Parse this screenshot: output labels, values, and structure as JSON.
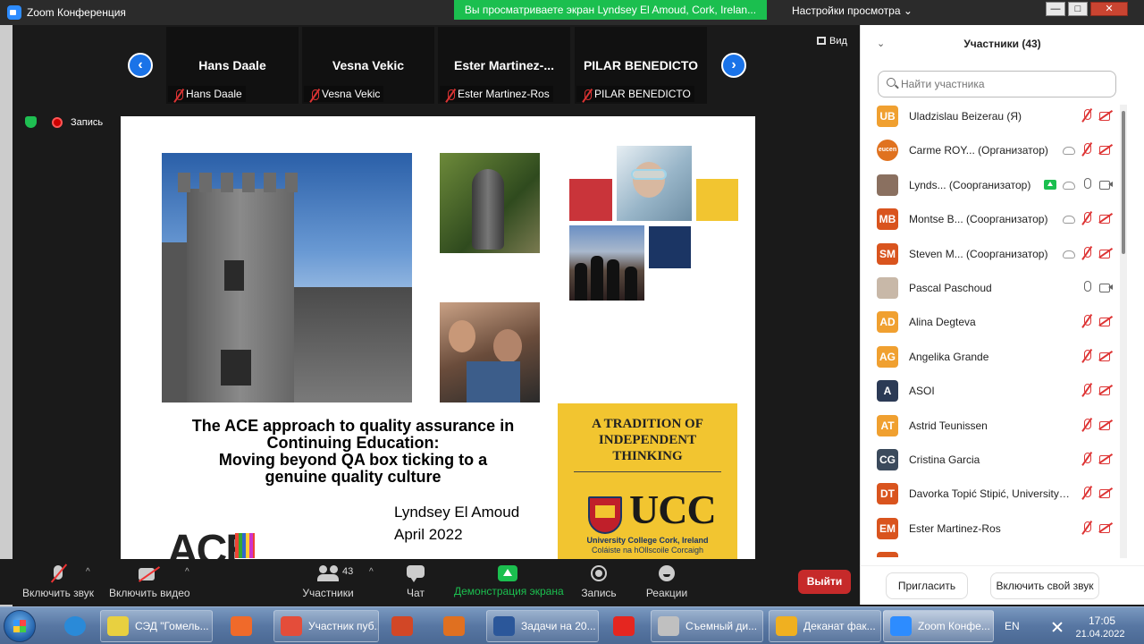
{
  "window": {
    "title": "Zoom Конференция",
    "share_banner": "Вы просматриваете экран Lyndsey El Amoud, Cork, Irelan...",
    "view_settings": "Настройки просмотра",
    "minimize": "—",
    "maximize": "□",
    "close": "✕"
  },
  "strip": {
    "prev": "‹",
    "next": "›",
    "view_label": "Вид",
    "tiles": [
      {
        "big": "Hans Daale",
        "small": "Hans Daale"
      },
      {
        "big": "Vesna Vekic",
        "small": "Vesna Vekic"
      },
      {
        "big": "Ester  Martinez-...",
        "small": "Ester Martinez-Ros"
      },
      {
        "big": "PILAR BENEDICTO",
        "small": "PILAR BENEDICTO"
      }
    ]
  },
  "recording": {
    "label": "Запись"
  },
  "slide": {
    "title_lines": [
      "The ACE approach to quality assurance in",
      "Continuing Education:",
      "Moving beyond QA box ticking to a",
      "genuine quality culture"
    ],
    "author": "Lyndsey El Amoud",
    "date": "April 2022",
    "ace_logo": "ACE",
    "ucc_tagline_lines": [
      "A TRADITION OF",
      "INDEPENDENT",
      "THINKING"
    ],
    "ucc_brand": "UCC",
    "ucc_english": "University College Cork, Ireland",
    "ucc_irish": "Coláiste na hOllscoile Corcaigh"
  },
  "participants": {
    "title": "Участники (43)",
    "search_placeholder": "Найти участника",
    "colors": {
      "orange": "#e0721f",
      "navy": "#2b3a55",
      "dark": "#3b4a5c"
    },
    "items": [
      {
        "initials": "UB",
        "avatar_color": "#f0a030",
        "name": "Uladzislau Beizerau (Я)",
        "icons": [
          "mic-off-icon",
          "video-off-icon"
        ]
      },
      {
        "initials": "eucen",
        "avatar_color": "#e0721f",
        "name": "Carme ROY... (Организатор)",
        "icons": [
          "cloud-icon",
          "mic-off-icon",
          "video-off-icon"
        ]
      },
      {
        "initials": "",
        "avatar_color": "#8a7060",
        "name": "Lynds... (Соорганизатор)",
        "icons": [
          "share-icon",
          "cloud-icon",
          "mic-on-icon",
          "video-on-icon"
        ]
      },
      {
        "initials": "MB",
        "avatar_color": "#d9541e",
        "name": "Montse B... (Соорганизатор)",
        "icons": [
          "cloud-icon",
          "mic-off-icon",
          "video-off-icon"
        ]
      },
      {
        "initials": "SM",
        "avatar_color": "#d9541e",
        "name": "Steven M... (Соорганизатор)",
        "icons": [
          "cloud-icon",
          "mic-off-icon",
          "video-off-icon"
        ]
      },
      {
        "initials": "",
        "avatar_color": "#c8b8a8",
        "name": "Pascal Paschoud",
        "icons": [
          "mic-on-icon",
          "video-on-icon"
        ]
      },
      {
        "initials": "AD",
        "avatar_color": "#f0a030",
        "name": "Alina Degteva",
        "icons": [
          "mic-off-icon",
          "video-off-icon"
        ]
      },
      {
        "initials": "AG",
        "avatar_color": "#f0a030",
        "name": "Angelika Grande",
        "icons": [
          "mic-off-icon",
          "video-off-icon"
        ]
      },
      {
        "initials": "A",
        "avatar_color": "#2b3a55",
        "name": "ASOI",
        "icons": [
          "mic-off-icon",
          "video-off-icon"
        ]
      },
      {
        "initials": "AT",
        "avatar_color": "#f0a030",
        "name": "Astrid Teunissen",
        "icons": [
          "mic-off-icon",
          "video-off-icon"
        ]
      },
      {
        "initials": "CG",
        "avatar_color": "#3b4a5c",
        "name": "Cristina Garcia",
        "icons": [
          "mic-off-icon",
          "video-off-icon"
        ]
      },
      {
        "initials": "DT",
        "avatar_color": "#d9541e",
        "name": "Davorka Topić Stipić, University ...",
        "icons": [
          "mic-off-icon",
          "video-off-icon"
        ]
      },
      {
        "initials": "EM",
        "avatar_color": "#d9541e",
        "name": "Ester Martinez-Ros",
        "icons": [
          "mic-off-icon",
          "video-off-icon"
        ]
      },
      {
        "initials": "",
        "avatar_color": "#d9541e",
        "name": "",
        "icons": []
      }
    ],
    "invite_label": "Пригласить",
    "unmute_self_label": "Включить свой звук"
  },
  "toolbar": {
    "audio_label": "Включить звук",
    "video_label": "Включить видео",
    "participants_label": "Участники",
    "participants_count": "43",
    "chat_label": "Чат",
    "share_label": "Демонстрация экрана",
    "record_label": "Запись",
    "reactions_label": "Реакции",
    "exit_label": "Выйти",
    "caret": "^"
  },
  "taskbar": {
    "windows": [
      {
        "label": "СЭД \"Гомель...",
        "color": "#e8d040"
      },
      {
        "label": "",
        "color": "#f06a2a"
      },
      {
        "label": "Участник пуб...",
        "color": "#e44d3a"
      },
      {
        "label": "",
        "color": "#d24726"
      },
      {
        "label": "",
        "color": "#e07020"
      },
      {
        "label": "Задачи на 20...",
        "color": "#2b579a"
      },
      {
        "label": "",
        "color": "#e52620"
      },
      {
        "label": "Съемный ди...",
        "color": "#c0c0c0"
      },
      {
        "label": "Деканат фак...",
        "color": "#f0b020"
      },
      {
        "label": "Zoom Конфе...",
        "color": "#2d8cff"
      }
    ],
    "lang": "EN",
    "time": "17:05",
    "date": "21.04.2022"
  }
}
